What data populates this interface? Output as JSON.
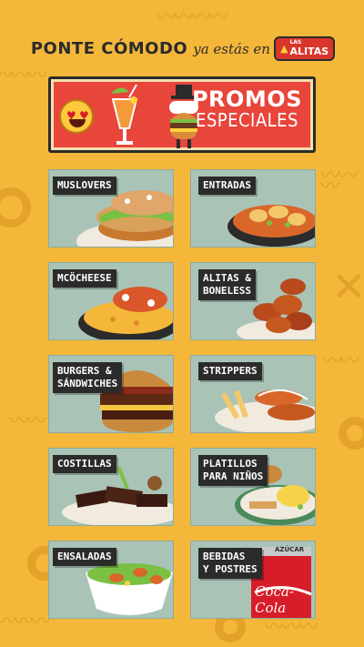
{
  "header": {
    "main": "PONTE CÓMODO",
    "sub": "ya estás en",
    "brand_top": "LAS",
    "brand_name": "ALITAS"
  },
  "banner": {
    "line1": "PROMOS",
    "line2": "ESPECIALES",
    "icons": [
      "heart-eyes-emoji-icon",
      "cocktail-icon",
      "burger-mascot-icon"
    ]
  },
  "menu": [
    {
      "label": "MUSLOVERS",
      "food": "chicken-sandwich"
    },
    {
      "label": "ENTRADAS",
      "food": "potato-skillet"
    },
    {
      "label": "MCÖCHEESE",
      "food": "mac-cheese-skillet"
    },
    {
      "label": "ALITAS &\nBONELESS",
      "food": "wings"
    },
    {
      "label": "BURGERS &\nSÁNDWICHES",
      "food": "burger"
    },
    {
      "label": "STRIPPERS",
      "food": "chicken-strips"
    },
    {
      "label": "COSTILLAS",
      "food": "ribs"
    },
    {
      "label": "PLATILLOS\nPARA NIÑOS",
      "food": "kids-plate"
    },
    {
      "label": "ENSALADAS",
      "food": "salad"
    },
    {
      "label": "BEBIDAS\nY POSTRES",
      "food": "soda-can"
    }
  ],
  "soda_can_text": "Coca-Cola",
  "soda_can_top": "AZÚCAR",
  "colors": {
    "background": "#f4b73a",
    "banner": "#e8453b",
    "card_bg": "#a9c4b7",
    "label_bg": "#2b2b2b"
  }
}
